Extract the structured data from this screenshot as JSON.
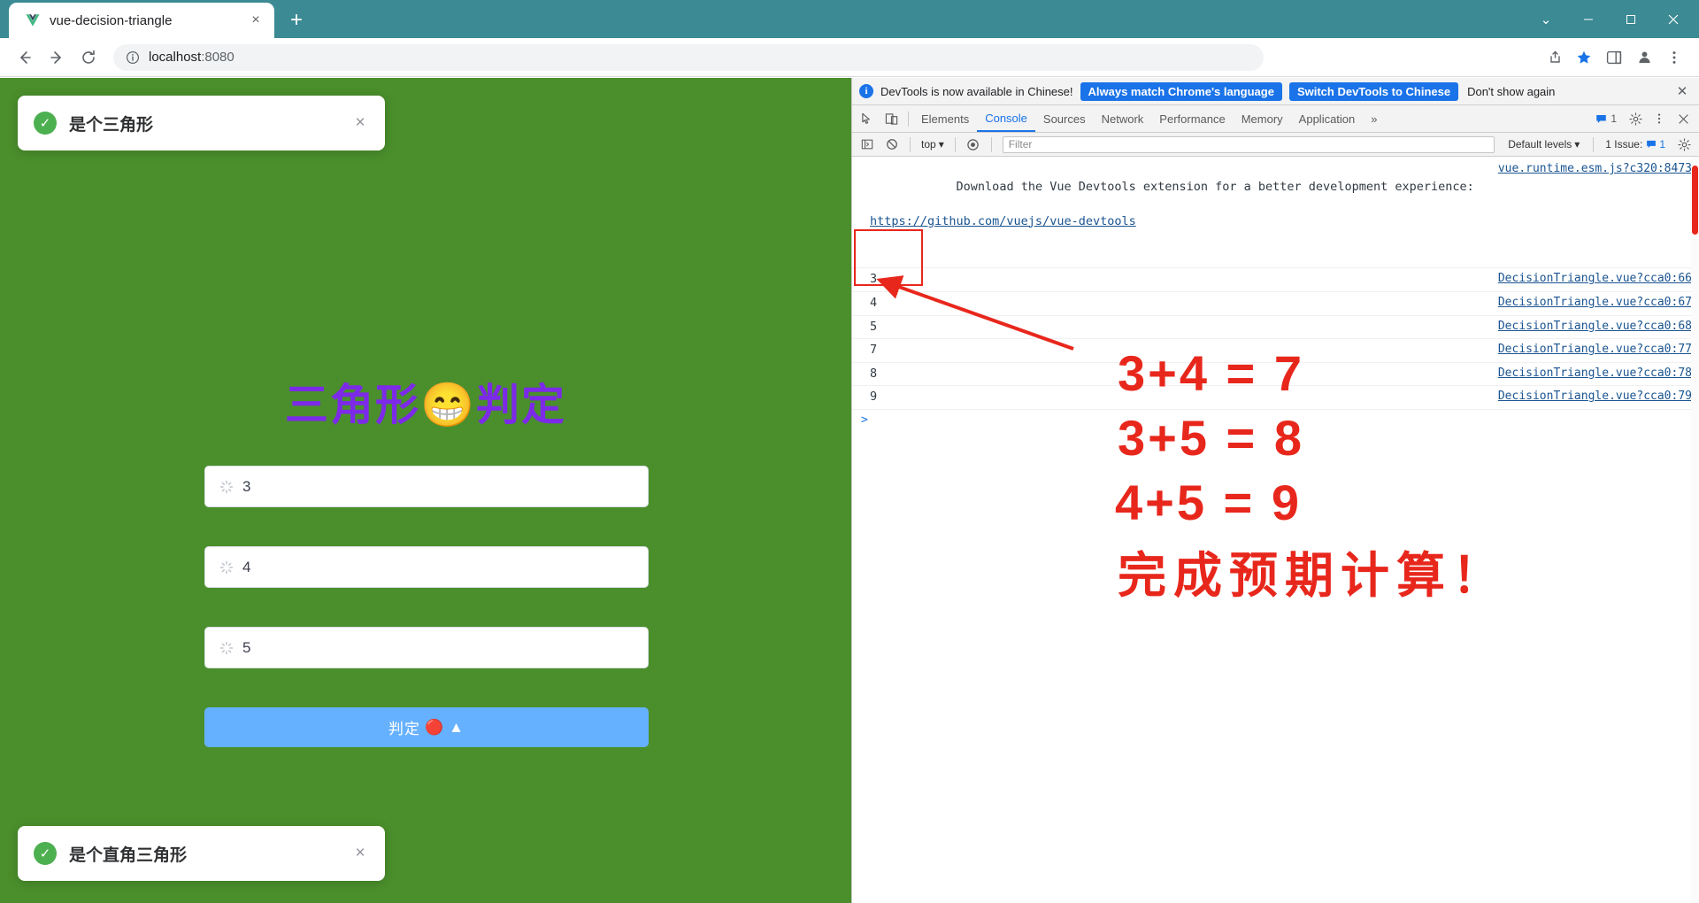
{
  "browser": {
    "tab": {
      "title": "vue-decision-triangle",
      "favicon": "vue-logo-icon",
      "close": "×"
    },
    "new_tab": "+",
    "window_controls": {
      "minimize": "–",
      "maximize": "□",
      "close": "✕",
      "chevron": "⌄"
    },
    "nav": {
      "back": "←",
      "forward": "→",
      "reload": "⟳"
    },
    "omnibox": {
      "host": "localhost",
      "port": ":8080",
      "info_icon": "info-circle-icon"
    },
    "toolbar_icons": [
      "share-icon",
      "bookmark-star-icon",
      "sidepanel-icon",
      "profile-icon",
      "menu-kebab-icon"
    ]
  },
  "page": {
    "title_text": "三角形",
    "title_emoji": "😁",
    "title_suffix": "判定",
    "toast_top": {
      "message": "是个三角形",
      "check": "✓",
      "close": "×"
    },
    "toast_bottom": {
      "message": "是个直角三角形",
      "check": "✓",
      "close": "×"
    },
    "fields": [
      {
        "name": "side-a",
        "value": "3",
        "icon": "loading-spinner-icon"
      },
      {
        "name": "side-b",
        "value": "4",
        "icon": "loading-spinner-icon"
      },
      {
        "name": "side-c",
        "value": "5",
        "icon": "loading-spinner-icon"
      }
    ],
    "button": {
      "label": "判定",
      "emoji1": "🔴",
      "emoji2": "▲"
    },
    "bg_color": "#4a8f2c",
    "title_color": "#7c2ae8",
    "button_color": "#66b1ff"
  },
  "devtools": {
    "banner": {
      "info": "i",
      "text": "DevTools is now available in Chinese!",
      "btn_always": "Always match Chrome's language",
      "btn_switch": "Switch DevTools to Chinese",
      "link_dont_show": "Don't show again",
      "close": "✕"
    },
    "tabs": [
      {
        "label": "Elements",
        "active": false
      },
      {
        "label": "Console",
        "active": true
      },
      {
        "label": "Sources",
        "active": false
      },
      {
        "label": "Network",
        "active": false
      },
      {
        "label": "Performance",
        "active": false
      },
      {
        "label": "Memory",
        "active": false
      },
      {
        "label": "Application",
        "active": false
      }
    ],
    "tabs_overflow": "»",
    "message_count": "1",
    "tool_icons": {
      "inspect": "inspect-cursor-icon",
      "device": "device-toggle-icon",
      "settings": "gear-icon",
      "more": "menu-kebab-icon",
      "close": "✕"
    },
    "console_toolbar": {
      "sidebar_icon": "console-sidebar-icon",
      "clear_icon": "clear-console-icon",
      "context": "top",
      "context_caret": "▾",
      "eye_icon": "live-expression-icon",
      "filter_placeholder": "Filter",
      "levels": "Default levels",
      "levels_caret": "▾",
      "issues_label": "1 Issue:",
      "issues_count": "1",
      "settings_icon": "gear-icon"
    },
    "logs": [
      {
        "text": "Download the Vue Devtools extension for a better development experience:",
        "link": "https://github.com/vuejs/vue-devtools",
        "source": "vue.runtime.esm.js?c320:8473",
        "highlighted": false
      },
      {
        "text": "3",
        "link": "",
        "source": "DecisionTriangle.vue?cca0:66",
        "highlighted": false
      },
      {
        "text": "4",
        "link": "",
        "source": "DecisionTriangle.vue?cca0:67",
        "highlighted": false
      },
      {
        "text": "5",
        "link": "",
        "source": "DecisionTriangle.vue?cca0:68",
        "highlighted": false
      },
      {
        "text": "7",
        "link": "",
        "source": "DecisionTriangle.vue?cca0:77",
        "highlighted": true
      },
      {
        "text": "8",
        "link": "",
        "source": "DecisionTriangle.vue?cca0:78",
        "highlighted": true
      },
      {
        "text": "9",
        "link": "",
        "source": "DecisionTriangle.vue?cca0:79",
        "highlighted": true
      }
    ],
    "prompt": ">"
  },
  "annotations": {
    "lines": [
      "3+4  =  7",
      "3+5  =  8",
      "4+5  =  9"
    ],
    "conclusion": "完成预期计算！",
    "color": "#e8271c",
    "arrow": "red-arrow-pointing-to-console"
  }
}
